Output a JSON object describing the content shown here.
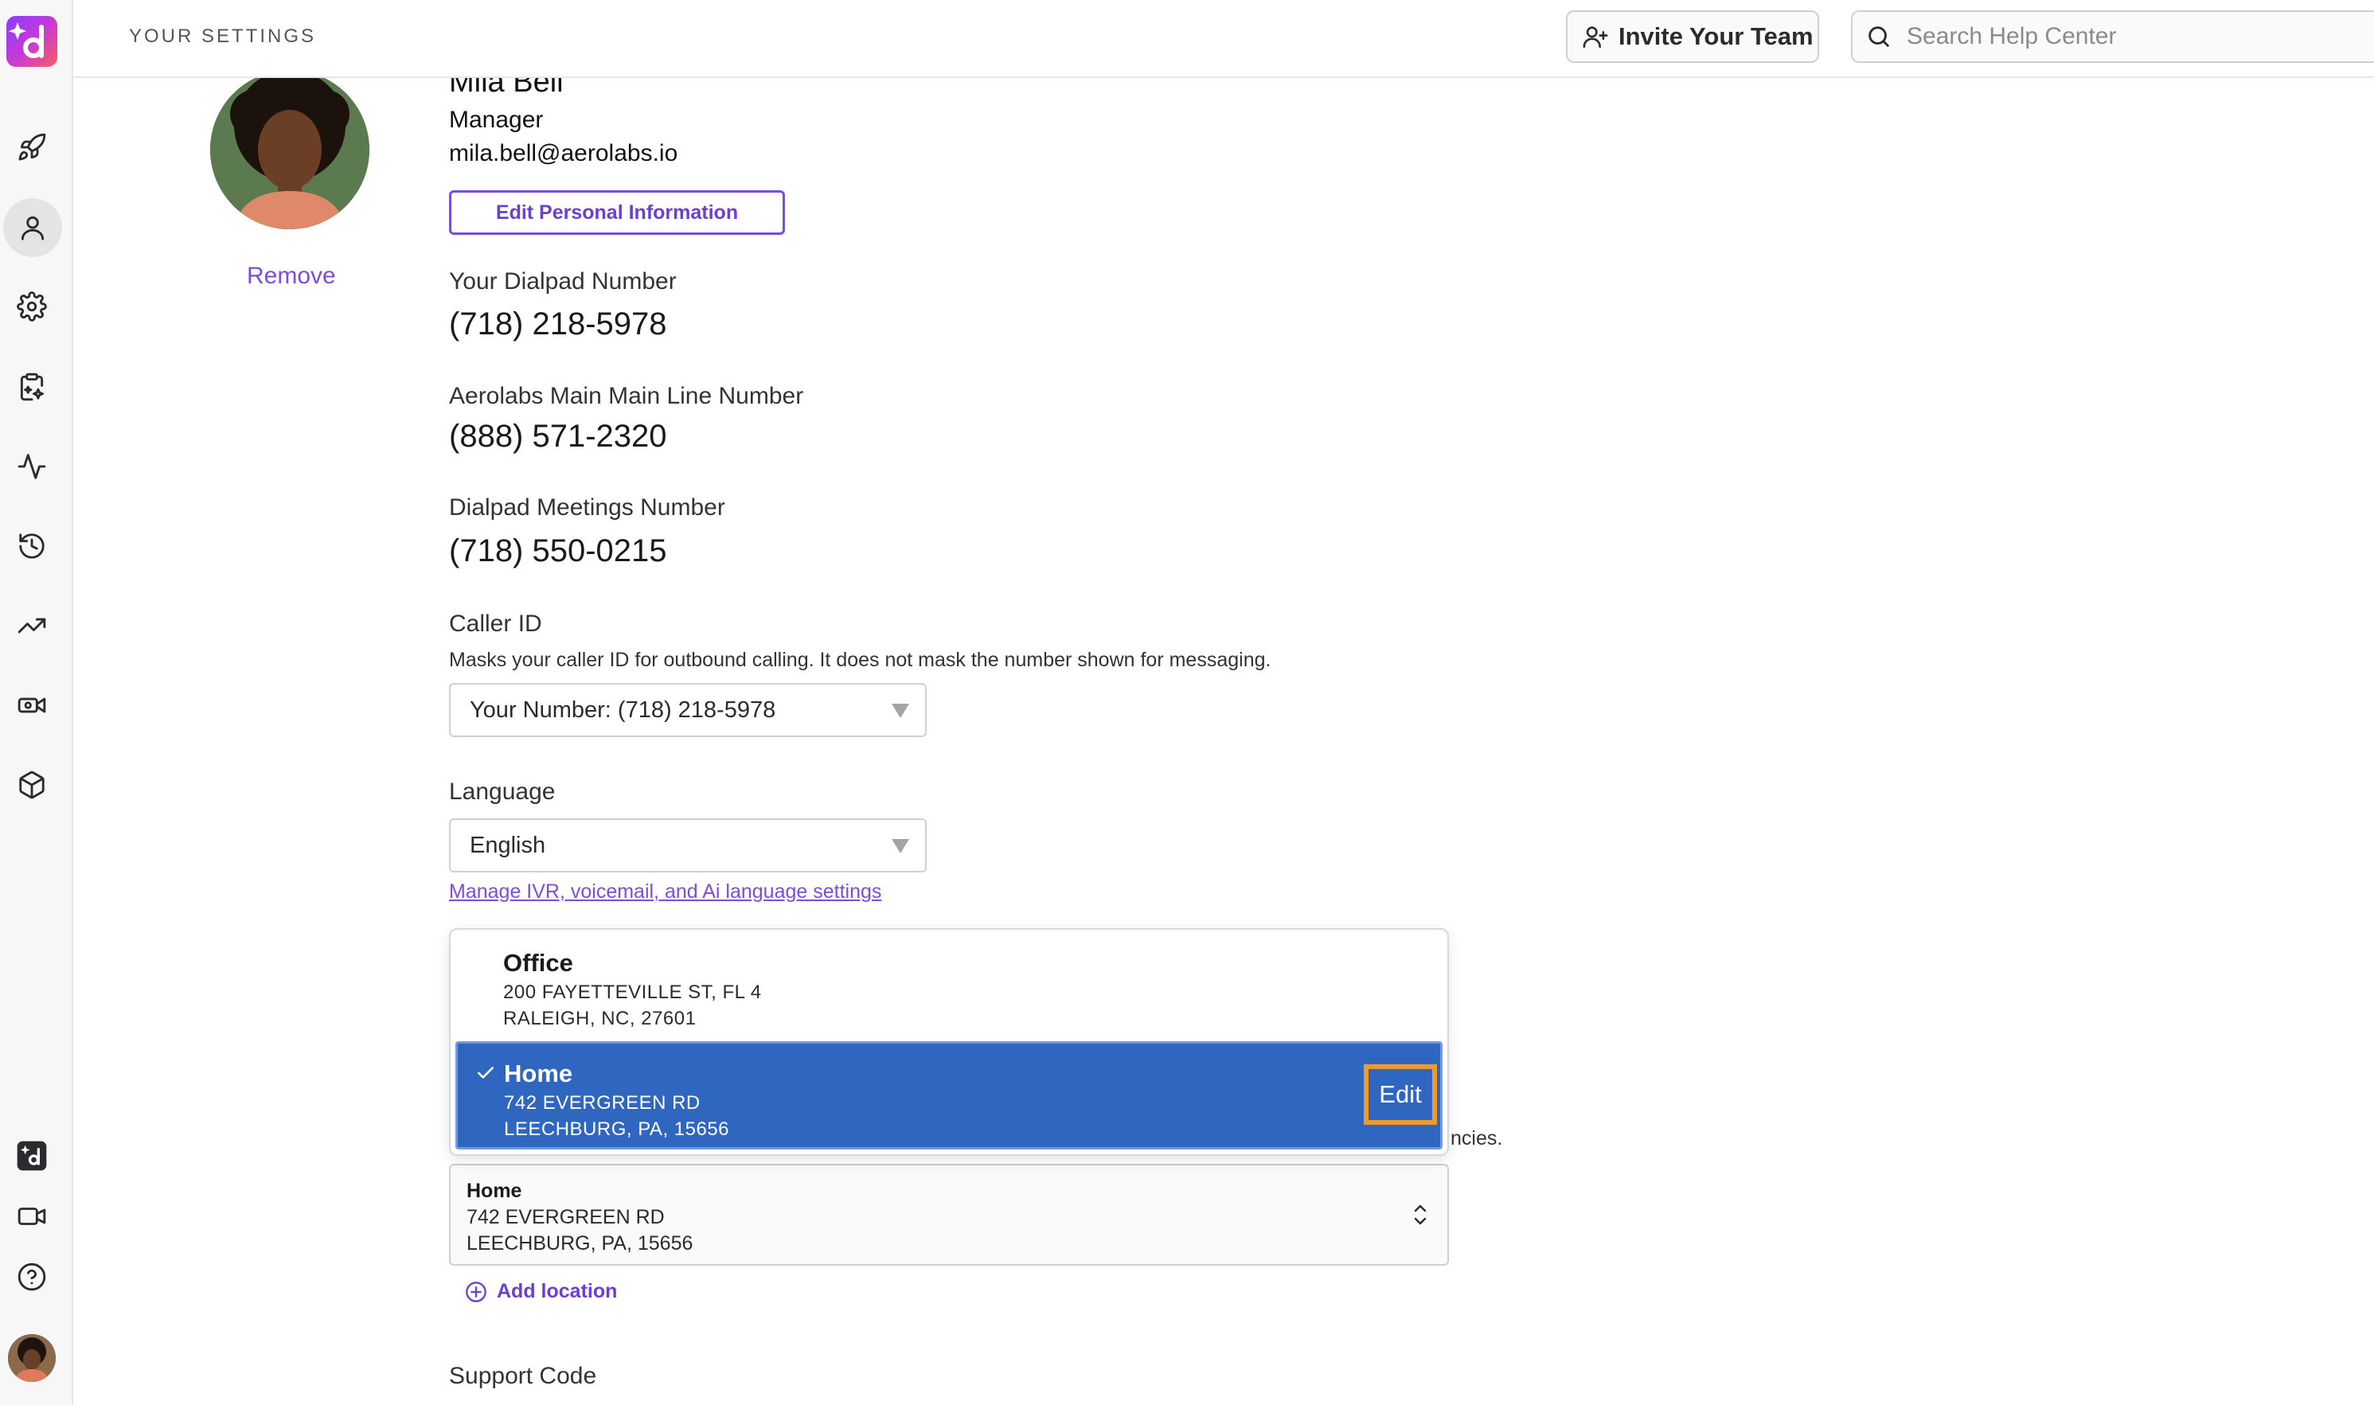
{
  "app": {
    "logo_icon": "dialpad-ai-logo",
    "brand_colors": {
      "accent": "#7c4ddb",
      "selected": "#2f66c0",
      "highlight": "#f09a2c"
    }
  },
  "rail": {
    "items": [
      {
        "icon": "rocket-icon",
        "active": false
      },
      {
        "icon": "person-icon",
        "active": true
      },
      {
        "icon": "gear-icon",
        "active": false
      },
      {
        "icon": "clipboard-sparkle-icon",
        "active": false
      },
      {
        "icon": "pulse-icon",
        "active": false
      },
      {
        "icon": "history-icon",
        "active": false
      },
      {
        "icon": "trending-up-icon",
        "active": false
      },
      {
        "icon": "video-camera-settings-icon",
        "active": false
      },
      {
        "icon": "cube-icon",
        "active": false
      }
    ],
    "bottom_items": [
      "dialpad-ai-icon",
      "video-icon",
      "help-icon",
      "avatar"
    ]
  },
  "topbar": {
    "title": "YOUR SETTINGS",
    "invite_label": "Invite Your Team",
    "search_placeholder": "Search Help Center"
  },
  "profile": {
    "name": "Mila Bell",
    "role": "Manager",
    "email": "mila.bell@aerolabs.io",
    "edit_label": "Edit Personal Information",
    "remove_label": "Remove"
  },
  "numbers": [
    {
      "label": "Your Dialpad Number",
      "value": "(718) 218-5978"
    },
    {
      "label": "Aerolabs Main Main Line Number",
      "value": "(888) 571-2320"
    },
    {
      "label": "Dialpad Meetings Number",
      "value": "(718) 550-0215"
    }
  ],
  "caller_id": {
    "label": "Caller ID",
    "help": "Masks your caller ID for outbound calling. It does not mask the number shown for messaging.",
    "selected": "Your Number: (718) 218-5978"
  },
  "language": {
    "label": "Language",
    "selected": "English",
    "manage_link": "Manage IVR, voicemail, and Ai language settings"
  },
  "location": {
    "peek_text": "ncies.",
    "options": [
      {
        "title": "Office",
        "line1": "200 FAYETTEVILLE ST, FL 4",
        "line2": "RALEIGH, NC, 27601",
        "selected": false
      },
      {
        "title": "Home",
        "line1": "742 EVERGREEN RD",
        "line2": "LEECHBURG, PA, 15656",
        "selected": true,
        "edit_label": "Edit"
      }
    ],
    "current": {
      "title": "Home",
      "line1": "742 EVERGREEN RD",
      "line2": "LEECHBURG, PA, 15656"
    },
    "add_label": "Add location"
  },
  "support": {
    "label": "Support Code"
  }
}
